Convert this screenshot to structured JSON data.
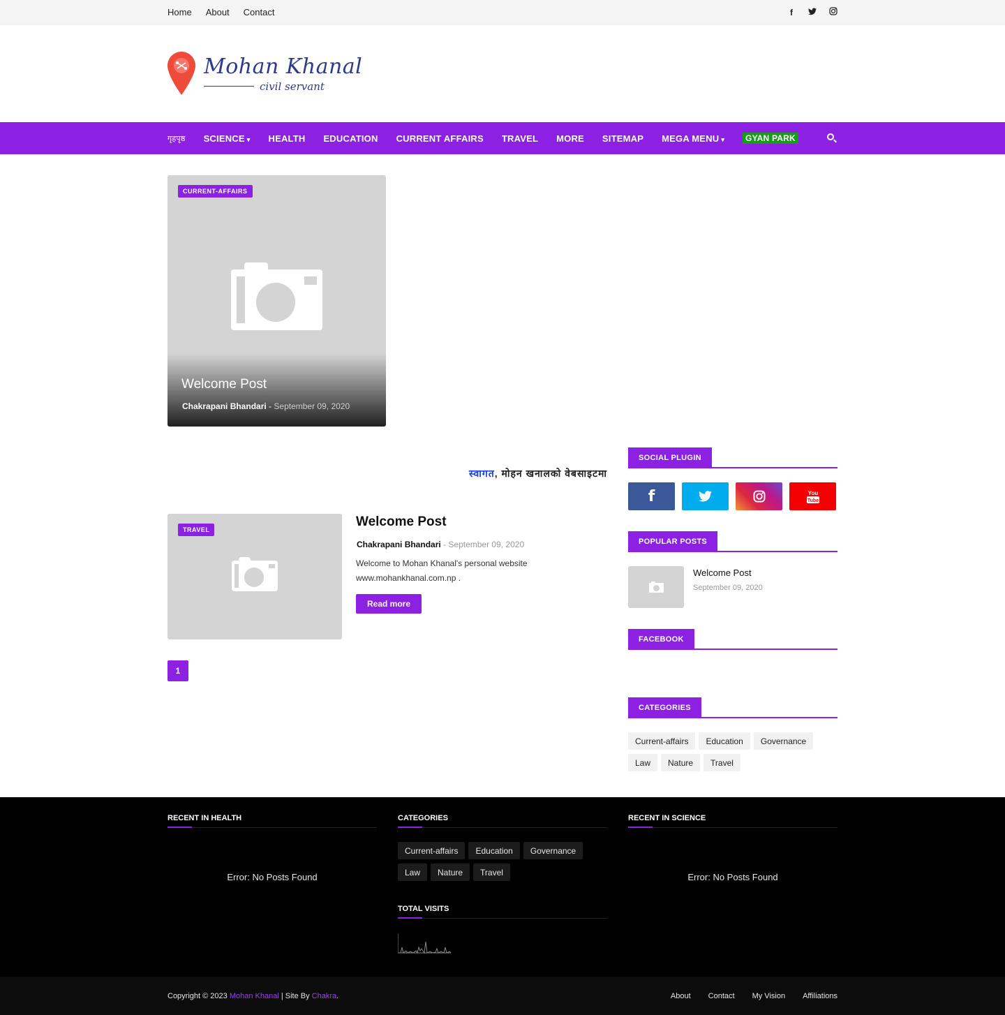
{
  "topbar": {
    "links": [
      "Home",
      "About",
      "Contact"
    ],
    "social_icons": [
      "facebook-icon",
      "twitter-icon",
      "instagram-icon"
    ]
  },
  "logo": {
    "name": "Mohan Khanal",
    "tagline": "civil servant",
    "pin_color": "#ef4b3a",
    "text_color": "#2d3a8c"
  },
  "nav": {
    "items": [
      {
        "label": "गृहपृष्ठ",
        "chevron": false
      },
      {
        "label": "Science",
        "chevron": true
      },
      {
        "label": "Health",
        "chevron": false
      },
      {
        "label": "Education",
        "chevron": false
      },
      {
        "label": "Current Affairs",
        "chevron": false
      },
      {
        "label": "Travel",
        "chevron": false
      },
      {
        "label": "More",
        "chevron": false
      },
      {
        "label": "Sitemap",
        "chevron": false
      },
      {
        "label": "Mega Menu",
        "chevron": true
      }
    ],
    "highlight": "GYAN PARK",
    "accent": "#8c21e4"
  },
  "featured": {
    "badge": "current-affairs",
    "title": "Welcome Post",
    "author": "Chakrapani Bhandari",
    "separator": "-",
    "date": "September 09, 2020"
  },
  "ticker": {
    "highlight": "स्वागत",
    "text": ", मोहन खनालको वेबसाइटमा"
  },
  "post": {
    "badge": "Travel",
    "title": "Welcome Post",
    "author": "Chakrapani Bhandari",
    "separator": "-",
    "date": "September 09, 2020",
    "excerpt": "Welcome to Mohan Khanal's personal website www.mohankhanal.com.np .",
    "read_more": "Read more"
  },
  "pager": {
    "current": "1"
  },
  "sidebar": {
    "social_title": "Social Plugin",
    "social_buttons": [
      {
        "name": "facebook",
        "color": "#3b5998"
      },
      {
        "name": "twitter",
        "color": "#00acee"
      },
      {
        "name": "instagram",
        "color": "#c13584"
      },
      {
        "name": "youtube",
        "color": "#f50000"
      }
    ],
    "popular_title": "Popular Posts",
    "popular": {
      "title": "Welcome Post",
      "date": "September 09, 2020"
    },
    "facebook_title": "Facebook",
    "categories_title": "Categories",
    "categories": [
      "Current-affairs",
      "Education",
      "Governance",
      "Law",
      "Nature",
      "Travel"
    ]
  },
  "footer": {
    "health_title": "Recent in Health",
    "health_error": "Error: No Posts Found",
    "categories_title": "Categories",
    "categories": [
      "Current-affairs",
      "Education",
      "Governance",
      "Law",
      "Nature",
      "Travel"
    ],
    "visits_title": "Total Visits",
    "science_title": "Recent in Science",
    "science_error": "Error: No Posts Found"
  },
  "bottombar": {
    "copyright_prefix": "Copyright © 2023",
    "site_name": "Mohan Khanal",
    "site_by": "| Site By",
    "builder": "Chakra",
    "end": ".",
    "links": [
      "About",
      "Contact",
      "My Vision",
      "Affiliations"
    ]
  }
}
